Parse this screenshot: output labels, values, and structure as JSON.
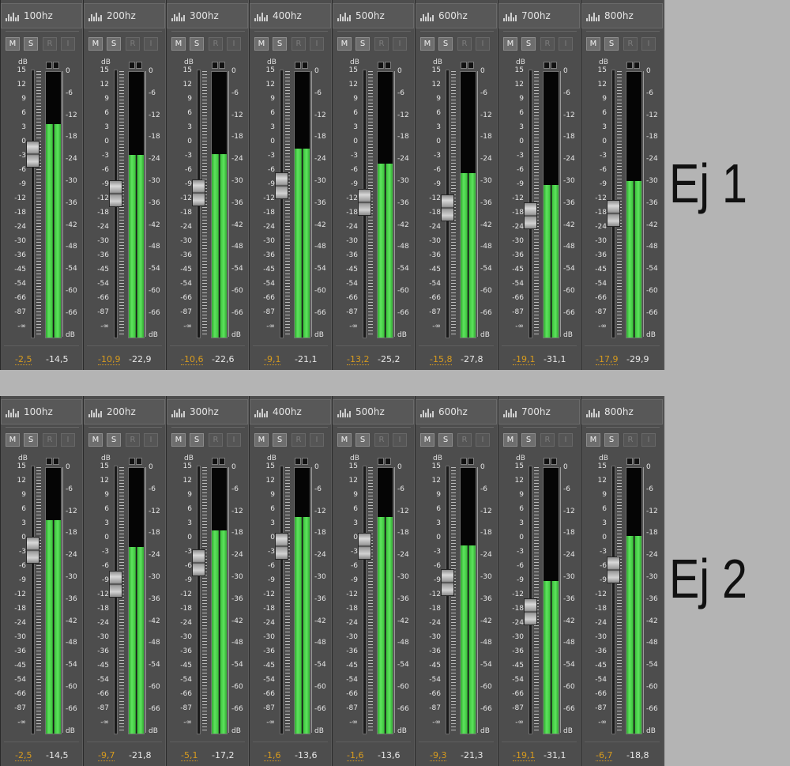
{
  "button_labels": {
    "mute": "M",
    "solo": "S",
    "read": "R",
    "input": "I"
  },
  "db_unit": "dB",
  "colors": {
    "value_left": "#d79b1e",
    "meter_green": "#5ee25e",
    "background": "#b4b4b4"
  },
  "icons": {
    "track": "waveform-icon"
  },
  "fader_scale": [
    "15",
    "12",
    "9",
    "6",
    "3",
    "0",
    "-3",
    "-6",
    "-9",
    "-12",
    "-18",
    "-24",
    "-30",
    "-36",
    "-45",
    "-54",
    "-66",
    "-87",
    "-∞"
  ],
  "meter_scale": [
    "0",
    "-6",
    "-12",
    "-18",
    "-24",
    "-30",
    "-36",
    "-42",
    "-48",
    "-54",
    "-60",
    "-66",
    "dB"
  ],
  "examples": [
    {
      "label": "Ej 1",
      "strips": [
        {
          "name": "100hz",
          "fader_value": "-2,5",
          "peak_value": "-14,5",
          "fader_db": -2.5,
          "level_db": -14.5
        },
        {
          "name": "200hz",
          "fader_value": "-10,9",
          "peak_value": "-22,9",
          "fader_db": -10.9,
          "level_db": -22.9
        },
        {
          "name": "300hz",
          "fader_value": "-10,6",
          "peak_value": "-22,6",
          "fader_db": -10.6,
          "level_db": -22.6
        },
        {
          "name": "400hz",
          "fader_value": "-9,1",
          "peak_value": "-21,1",
          "fader_db": -9.1,
          "level_db": -21.1
        },
        {
          "name": "500hz",
          "fader_value": "-13,2",
          "peak_value": "-25,2",
          "fader_db": -13.2,
          "level_db": -25.2
        },
        {
          "name": "600hz",
          "fader_value": "-15,8",
          "peak_value": "-27,8",
          "fader_db": -15.8,
          "level_db": -27.8
        },
        {
          "name": "700hz",
          "fader_value": "-19,1",
          "peak_value": "-31,1",
          "fader_db": -19.1,
          "level_db": -31.1
        },
        {
          "name": "800hz",
          "fader_value": "-17,9",
          "peak_value": "-29,9",
          "fader_db": -17.9,
          "level_db": -29.9
        }
      ]
    },
    {
      "label": "Ej 2",
      "strips": [
        {
          "name": "100hz",
          "fader_value": "-2,5",
          "peak_value": "-14,5",
          "fader_db": -2.5,
          "level_db": -14.5
        },
        {
          "name": "200hz",
          "fader_value": "-9,7",
          "peak_value": "-21,8",
          "fader_db": -9.7,
          "level_db": -21.8
        },
        {
          "name": "300hz",
          "fader_value": "-5,1",
          "peak_value": "-17,2",
          "fader_db": -5.1,
          "level_db": -17.2
        },
        {
          "name": "400hz",
          "fader_value": "-1,6",
          "peak_value": "-13,6",
          "fader_db": -1.6,
          "level_db": -13.6
        },
        {
          "name": "500hz",
          "fader_value": "-1,6",
          "peak_value": "-13,6",
          "fader_db": -1.6,
          "level_db": -13.6
        },
        {
          "name": "600hz",
          "fader_value": "-9,3",
          "peak_value": "-21,3",
          "fader_db": -9.3,
          "level_db": -21.3
        },
        {
          "name": "700hz",
          "fader_value": "-19,1",
          "peak_value": "-31,1",
          "fader_db": -19.1,
          "level_db": -31.1
        },
        {
          "name": "800hz",
          "fader_value": "-6,7",
          "peak_value": "-18,8",
          "fader_db": -6.7,
          "level_db": -18.8
        }
      ]
    }
  ]
}
